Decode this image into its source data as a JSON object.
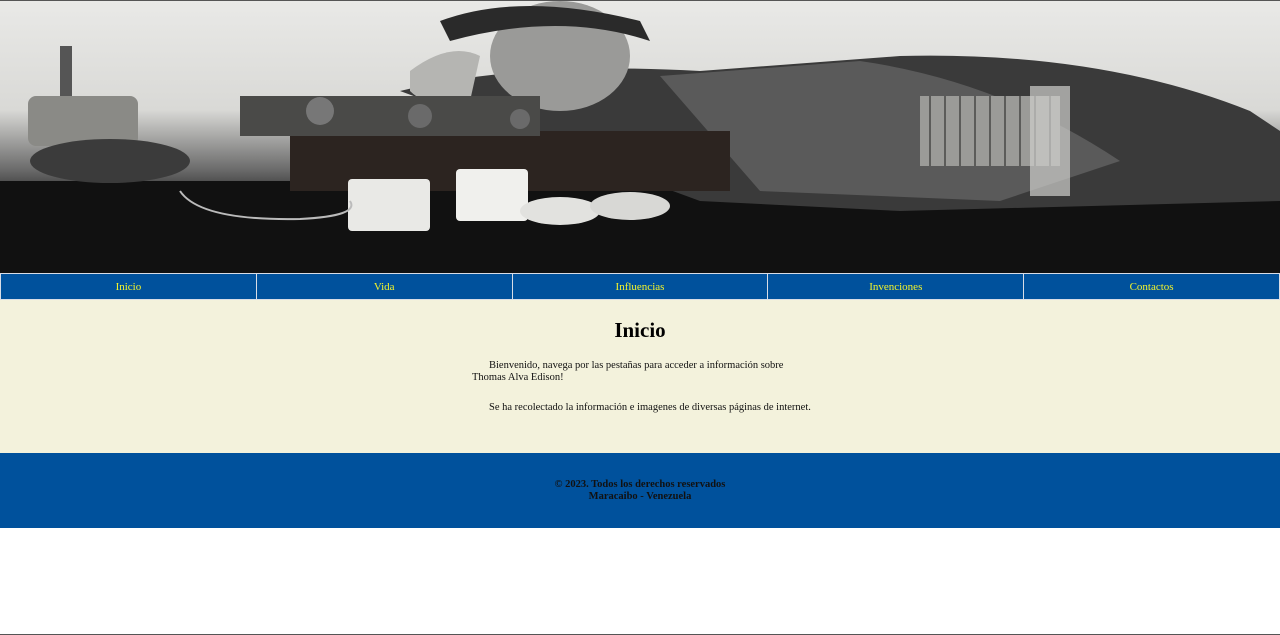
{
  "hero": {
    "photo_subject": "black-and-white photo of Thomas Alva Edison with phonograph"
  },
  "nav": {
    "items": [
      {
        "label": "Inicio"
      },
      {
        "label": "Vida"
      },
      {
        "label": "Influencias"
      },
      {
        "label": "Invenciones"
      },
      {
        "label": "Contactos"
      }
    ]
  },
  "main": {
    "title": "Inicio",
    "paragraphs": [
      "Bienvenido, navega por las pestañas para acceder a información sobre Thomas Alva Edison!",
      "Se ha recolectado la información e imagenes de diversas páginas de internet."
    ]
  },
  "footer": {
    "copyright": "© 2023. Todos los derechos reservados",
    "location": "Maracaibo - Venezuela"
  },
  "colors": {
    "nav_bg": "#00519c",
    "nav_text": "#f4f42a",
    "content_bg": "#f3f2dc",
    "footer_bg": "#00519c"
  }
}
